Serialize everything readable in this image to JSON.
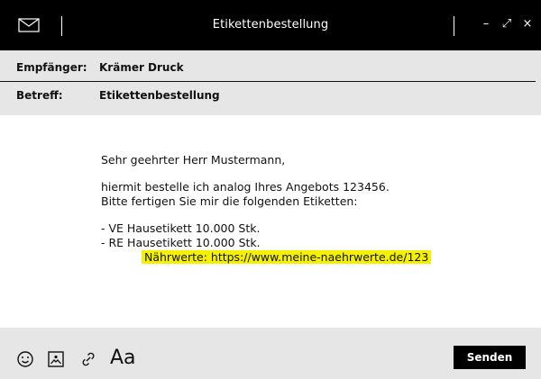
{
  "window": {
    "title": "Etikettenbestellung",
    "controls": [
      "–",
      "⤢",
      "×"
    ]
  },
  "header": {
    "recipient_label": "Empfänger:",
    "recipient_value": "Krämer Druck",
    "subject_label": "Betreff:",
    "subject_value": "Etikettenbestellung"
  },
  "body": {
    "greeting": "Sehr geehrter Herr Mustermann,",
    "line1": "hiermit bestelle ich analog Ihres Angebots 123456.",
    "line2": "Bitte fertigen Sie mir die folgenden Etiketten:",
    "item1": "- VE Hausetikett 10.000 Stk.",
    "item2": "- RE Hausetikett 10.000 Stk.",
    "note": "Nährwerte: https://www.meine-naehrwerte.de/123",
    "highlight_color": "#f4f000"
  },
  "footer": {
    "icons": [
      "emoji-icon",
      "image-icon",
      "link-icon"
    ],
    "font_label": "Aa",
    "send_label": "Senden"
  }
}
